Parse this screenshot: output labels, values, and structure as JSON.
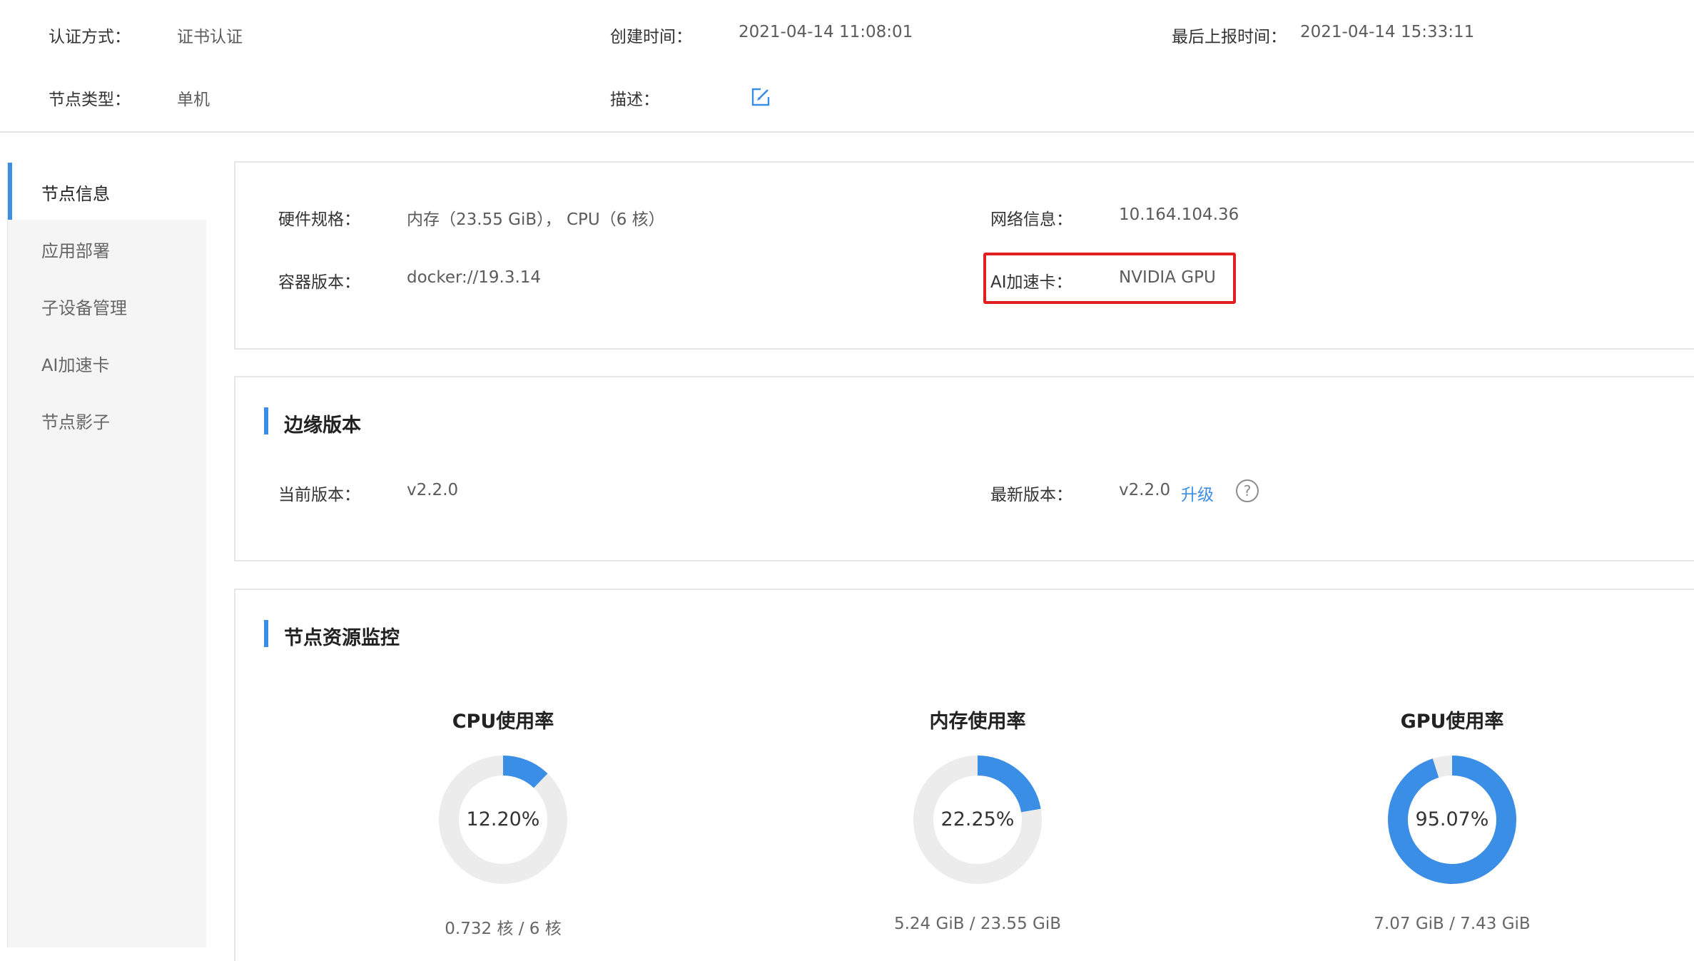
{
  "header": {
    "auth_method_label": "认证方式：",
    "auth_method_value": "证书认证",
    "created_label": "创建时间：",
    "created_value": "2021-04-14 11:08:01",
    "last_report_label": "最后上报时间：",
    "last_report_value": "2021-04-14 15:33:11",
    "node_type_label": "节点类型：",
    "node_type_value": "单机",
    "description_label": "描述：",
    "edit_icon": "edit-icon"
  },
  "sidebar": {
    "items": [
      {
        "label": "节点信息",
        "active": true
      },
      {
        "label": "应用部署",
        "active": false
      },
      {
        "label": "子设备管理",
        "active": false
      },
      {
        "label": "AI加速卡",
        "active": false
      },
      {
        "label": "节点影子",
        "active": false
      }
    ]
  },
  "node_info": {
    "hardware_label": "硬件规格：",
    "hardware_value": "内存（23.55 GiB），  CPU（6 核）",
    "network_label": "网络信息：",
    "network_value": "10.164.104.36",
    "container_label": "容器版本：",
    "container_value": "docker://19.3.14",
    "ai_card_label": "AI加速卡：",
    "ai_card_value": "NVIDIA GPU",
    "highlight_color": "#e02020"
  },
  "edge_version": {
    "title": "边缘版本",
    "current_label": "当前版本：",
    "current_value": "v2.2.0",
    "latest_label": "最新版本：",
    "latest_value": "v2.2.0",
    "upgrade_link": "升级",
    "help_icon": "?"
  },
  "monitoring": {
    "title": "节点资源监控",
    "accent_color": "#3a8ee6",
    "track_color": "#ececec",
    "gauges": [
      {
        "title": "CPU使用率",
        "percent_text": "12.20%",
        "value": 12.2,
        "detail": "0.732 核 / 6 核"
      },
      {
        "title": "内存使用率",
        "percent_text": "22.25%",
        "value": 22.25,
        "detail": "5.24 GiB / 23.55 GiB"
      },
      {
        "title": "GPU使用率",
        "percent_text": "95.07%",
        "value": 95.07,
        "detail": "7.07 GiB / 7.43 GiB"
      }
    ]
  }
}
